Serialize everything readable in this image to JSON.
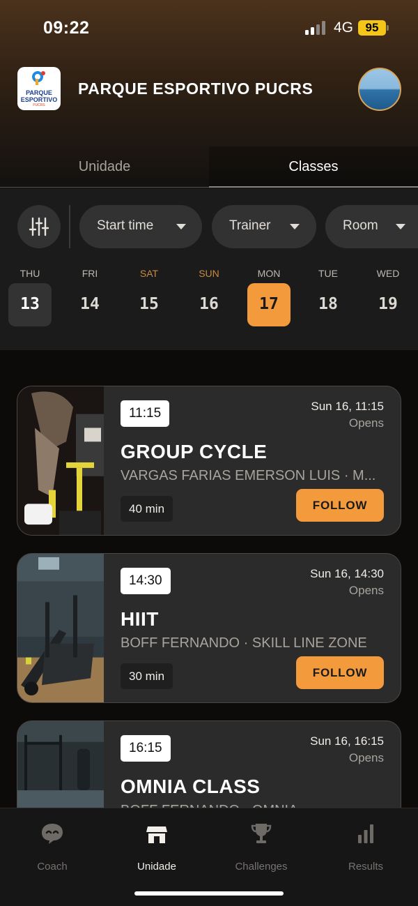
{
  "status_bar": {
    "time": "09:22",
    "network": "4G",
    "battery": "95"
  },
  "header": {
    "title": "PARQUE ESPORTIVO PUCRS",
    "logo_line1": "PARQUE",
    "logo_line2": "ESPORTIVO",
    "logo_line3": "PUCRS"
  },
  "tabs": [
    {
      "label": "Unidade",
      "active": false
    },
    {
      "label": "Classes",
      "active": true
    }
  ],
  "filters": {
    "icon": "sliders-icon",
    "chips": [
      {
        "label": "Start time"
      },
      {
        "label": "Trainer"
      },
      {
        "label": "Room"
      }
    ]
  },
  "days": [
    {
      "dow": "THU",
      "num": "13",
      "state": "today"
    },
    {
      "dow": "FRI",
      "num": "14",
      "state": ""
    },
    {
      "dow": "SAT",
      "num": "15",
      "state": "weekend"
    },
    {
      "dow": "SUN",
      "num": "16",
      "state": "weekend"
    },
    {
      "dow": "MON",
      "num": "17",
      "state": "selected"
    },
    {
      "dow": "TUE",
      "num": "18",
      "state": ""
    },
    {
      "dow": "WED",
      "num": "19",
      "state": ""
    }
  ],
  "classes": [
    {
      "time": "11:15",
      "when": "Sun 16, 11:15",
      "status": "Opens",
      "name": "GROUP CYCLE",
      "subtitle": "VARGAS FARIAS EMERSON LUIS  ·  M...",
      "duration": "40 min",
      "action": "FOLLOW"
    },
    {
      "time": "14:30",
      "when": "Sun 16, 14:30",
      "status": "Opens",
      "name": "HIIT",
      "subtitle": "BOFF FERNANDO  ·  SKILL LINE ZONE",
      "duration": "30 min",
      "action": "FOLLOW"
    },
    {
      "time": "16:15",
      "when": "Sun 16, 16:15",
      "status": "Opens",
      "name": "OMNIA CLASS",
      "subtitle": "BOFF FERNANDO  ·  OMNIA",
      "duration": "",
      "action": ""
    }
  ],
  "bottom_nav": [
    {
      "label": "Coach",
      "icon": "coach-icon",
      "active": false
    },
    {
      "label": "Unidade",
      "icon": "store-icon",
      "active": true
    },
    {
      "label": "Challenges",
      "icon": "trophy-icon",
      "active": false
    },
    {
      "label": "Results",
      "icon": "bar-chart-icon",
      "active": false
    }
  ],
  "colors": {
    "accent": "#f39a3c",
    "card": "#2b2b2b",
    "background": "#0c0b0a"
  }
}
